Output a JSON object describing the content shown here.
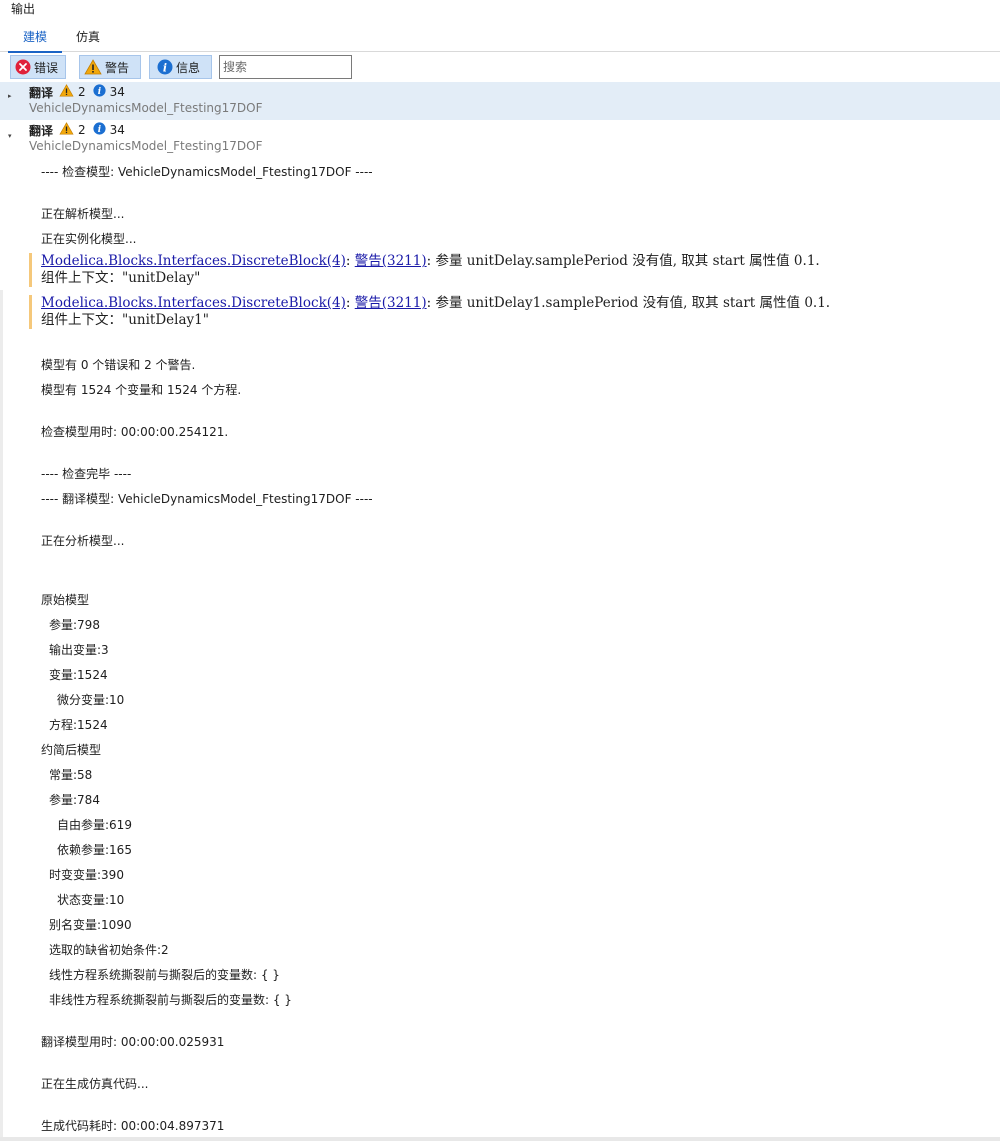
{
  "window": {
    "title": "输出"
  },
  "tabs": [
    {
      "label": "建模",
      "active": true
    },
    {
      "label": "仿真",
      "active": false
    }
  ],
  "toolbar": {
    "error_label": "错误",
    "warning_label": "警告",
    "info_label": "信息",
    "search_placeholder": "搜索"
  },
  "groups": [
    {
      "title": "翻译",
      "warnings": "2",
      "infos": "34",
      "subtitle": "VehicleDynamicsModel_Ftesting17DOF",
      "expanded": false,
      "selected": true
    },
    {
      "title": "翻译",
      "warnings": "2",
      "infos": "34",
      "subtitle": "VehicleDynamicsModel_Ftesting17DOF",
      "expanded": true,
      "selected": false
    }
  ],
  "log": {
    "check_header": "---- 检查模型: VehicleDynamicsModel_Ftesting17DOF ----",
    "parsing": "正在解析模型...",
    "instantiating": "正在实例化模型...",
    "warnings": [
      {
        "link": "Modelica.Blocks.Interfaces.DiscreteBlock(4)",
        "code": "警告(3211)",
        "message": ": 参量 unitDelay.samplePeriod 没有值, 取其 start 属性值 0.1.",
        "context": "组件上下文：\"unitDelay\""
      },
      {
        "link": "Modelica.Blocks.Interfaces.DiscreteBlock(4)",
        "code": "警告(3211)",
        "message": ": 参量 unitDelay1.samplePeriod 没有值, 取其 start 属性值 0.1.",
        "context": "组件上下文：\"unitDelay1\""
      }
    ],
    "summary_errors": "模型有 0 个错误和 2 个警告.",
    "summary_vars": "模型有 1524 个变量和 1524 个方程.",
    "check_time": "检查模型用时: 00:00:00.254121.",
    "check_done": "---- 检查完毕 ----",
    "translate_header": "---- 翻译模型: VehicleDynamicsModel_Ftesting17DOF ----",
    "analyzing": "正在分析模型...",
    "stats": [
      {
        "text": "原始模型",
        "indent": 0
      },
      {
        "text": "参量:798",
        "indent": 1
      },
      {
        "text": "输出变量:3",
        "indent": 1
      },
      {
        "text": "变量:1524",
        "indent": 1
      },
      {
        "text": "微分变量:10",
        "indent": 2
      },
      {
        "text": "方程:1524",
        "indent": 1
      },
      {
        "text": "约简后模型",
        "indent": 0
      },
      {
        "text": "常量:58",
        "indent": 1
      },
      {
        "text": "参量:784",
        "indent": 1
      },
      {
        "text": "自由参量:619",
        "indent": 2
      },
      {
        "text": "依赖参量:165",
        "indent": 2
      },
      {
        "text": "时变变量:390",
        "indent": 1
      },
      {
        "text": "状态变量:10",
        "indent": 2
      },
      {
        "text": "别名变量:1090",
        "indent": 1
      },
      {
        "text": "选取的缺省初始条件:2",
        "indent": 1
      },
      {
        "text": "线性方程系统撕裂前与撕裂后的变量数: { }",
        "indent": 1
      },
      {
        "text": "非线性方程系统撕裂前与撕裂后的变量数: { }",
        "indent": 1
      }
    ],
    "translate_time": "翻译模型用时: 00:00:00.025931",
    "generating": "正在生成仿真代码...",
    "gen_time": "生成代码耗时: 00:00:04.897371"
  },
  "colors": {
    "accent": "#1a63c5",
    "error": "#e0213a",
    "warning": "#f2a80c",
    "info": "#1c6fd1",
    "link": "#1a1aa8",
    "warn_bar": "#f5c87b"
  }
}
